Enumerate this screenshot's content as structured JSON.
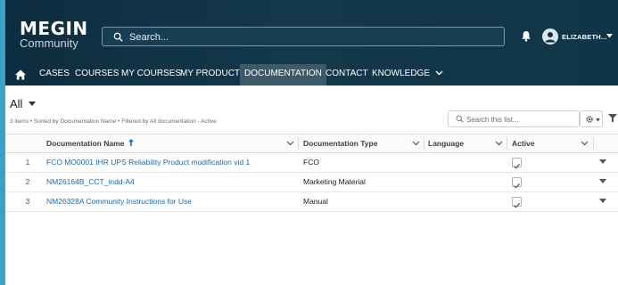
{
  "brand": {
    "name": "MEGIN",
    "sub": "Community"
  },
  "search": {
    "placeholder": "Search..."
  },
  "user": {
    "name": "ELIZABETH..."
  },
  "nav": {
    "items": [
      {
        "label": "CASES"
      },
      {
        "label": "COURSES"
      },
      {
        "label": "MY COURSES"
      },
      {
        "label": "MY PRODUCTS"
      },
      {
        "label": "DOCUMENTATION",
        "active": true
      },
      {
        "label": "CONTACT"
      },
      {
        "label": "KNOWLEDGE"
      }
    ]
  },
  "list": {
    "title": "All",
    "meta": "3 items • Sorted by Documentation Name • Filtered by All documentation - Active",
    "search_placeholder": "Search this list..."
  },
  "table": {
    "columns": {
      "name": "Documentation Name",
      "type": "Documentation Type",
      "language": "Language",
      "active": "Active"
    },
    "rows": [
      {
        "num": "1",
        "name": "FCO MO0001 IHR UPS Reliability Product modification vid 1",
        "type": "FCO",
        "language": "",
        "active": true
      },
      {
        "num": "2",
        "name": "NM26164B_CCT_indd-A4",
        "type": "Marketing Material",
        "language": "",
        "active": true
      },
      {
        "num": "3",
        "name": "NM26328A Community Instructions for Use",
        "type": "Manual",
        "language": "",
        "active": true
      }
    ]
  },
  "colors": {
    "header": "#0f3547",
    "accent": "#3aa2c9",
    "link": "#1a6aa8"
  }
}
